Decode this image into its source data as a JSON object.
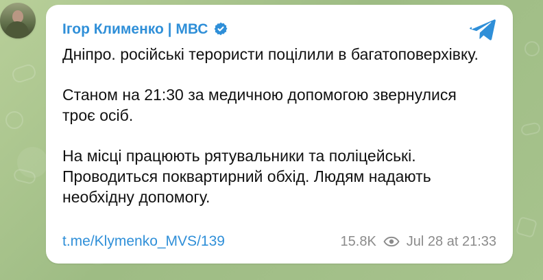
{
  "channel": {
    "name": "Ігор Клименко | МВС",
    "avatar_icon": "profile-photo",
    "verified_icon": "verified-badge-icon",
    "telegram_icon": "telegram-logo-icon"
  },
  "message": {
    "paragraphs": [
      "Дніпро. російські терористи поцілили в багатоповерхівку.",
      "Станом на 21:30 за медичною допомогою звернулися троє осіб.",
      "На місці працюють рятувальники та поліцейські. Проводиться поквартирний обхід. Людям надають необхідну допомогу."
    ]
  },
  "footer": {
    "link": "t.me/Klymenko_MVS/139",
    "views": "15.8K",
    "eye_icon": "eye-icon",
    "timestamp": "Jul 28 at 21:33"
  },
  "colors": {
    "accent": "#2f8fd8",
    "meta": "#8b8b8b",
    "text": "#111111",
    "card": "#ffffff",
    "background": "#a9c28d"
  }
}
